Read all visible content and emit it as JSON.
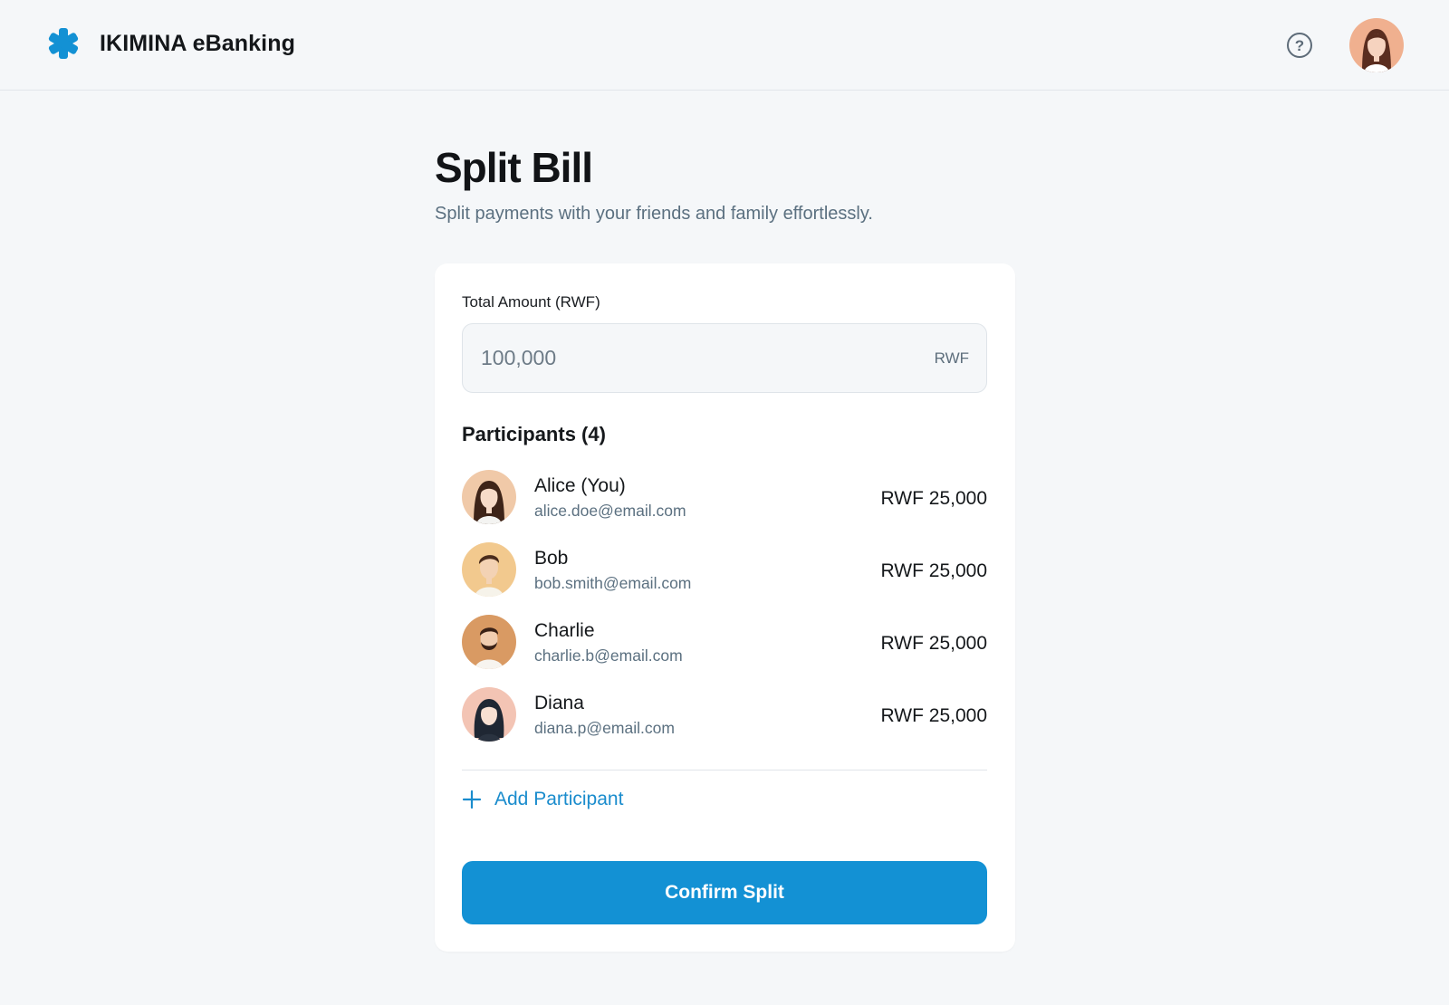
{
  "header": {
    "brand_name": "IKIMINA eBanking",
    "brand_icon": "asterisk-logo-icon",
    "help_icon": "help-circle-icon",
    "accent_color": "#1391d4"
  },
  "main": {
    "title": "Split Bill",
    "subtitle": "Split payments with your friends and family effortlessly."
  },
  "form": {
    "amount_label": "Total Amount (RWF)",
    "amount_placeholder": "100,000",
    "amount_suffix": "RWF",
    "participants_heading": "Participants (4)",
    "participants": [
      {
        "name": "Alice (You)",
        "email": "alice.doe@email.com",
        "amount": "RWF 25,000"
      },
      {
        "name": "Bob",
        "email": "bob.smith@email.com",
        "amount": "RWF 25,000"
      },
      {
        "name": "Charlie",
        "email": "charlie.b@email.com",
        "amount": "RWF 25,000"
      },
      {
        "name": "Diana",
        "email": "diana.p@email.com",
        "amount": "RWF 25,000"
      }
    ],
    "add_participant_label": "Add Participant",
    "confirm_label": "Confirm Split"
  }
}
